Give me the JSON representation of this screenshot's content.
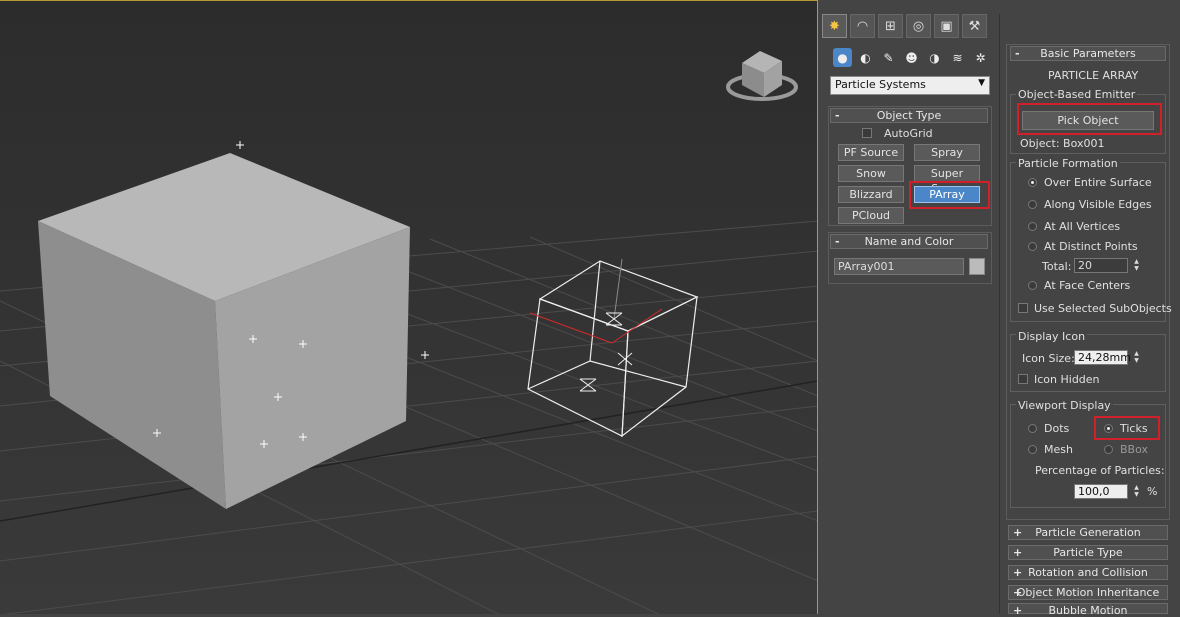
{
  "create_panel": {
    "tabs": [
      "create-tab",
      "modify-tab",
      "hierarchy-tab",
      "motion-tab",
      "display-tab",
      "utilities-tab"
    ],
    "category_dropdown": "Particle Systems",
    "object_type": {
      "title": "Object Type",
      "autogrid": "AutoGrid",
      "buttons": [
        "PF Source",
        "Spray",
        "Snow",
        "Super Spray",
        "Blizzard",
        "PArray",
        "PCloud"
      ]
    },
    "name_and_color": {
      "title": "Name and Color",
      "name_value": "PArray001"
    }
  },
  "basic_parameters": {
    "title": "Basic Parameters",
    "heading": "PARTICLE ARRAY",
    "emitter_group": "Object-Based Emitter",
    "pick_object": "Pick Object",
    "object_label": "Object: Box001",
    "formation_group": "Particle Formation",
    "formation_options": [
      "Over Entire Surface",
      "Along Visible Edges",
      "At All Vertices",
      "At Distinct Points",
      "At Face Centers"
    ],
    "total_label": "Total:",
    "total_value": "20",
    "use_selected": "Use Selected SubObjects",
    "display_icon_group": "Display Icon",
    "icon_size_label": "Icon Size:",
    "icon_size_value": "24,28mm",
    "icon_hidden": "Icon Hidden",
    "viewport_display_group": "Viewport Display",
    "vd_dots": "Dots",
    "vd_ticks": "Ticks",
    "vd_mesh": "Mesh",
    "vd_bbox": "BBox",
    "percentage_label": "Percentage of Particles:",
    "percentage_value": "100,0",
    "percent_sign": "%"
  },
  "collapsed_rollouts": [
    "Particle Generation",
    "Particle Type",
    "Rotation and Collision",
    "Object Motion Inheritance",
    "Bubble Motion"
  ],
  "rollout_plus": "+",
  "rollout_minus": "-"
}
